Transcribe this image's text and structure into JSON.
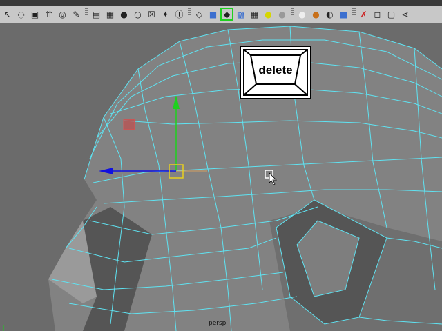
{
  "app": {
    "toolbar": {
      "icons": [
        "select-tool-icon",
        "lasso-icon",
        "paint-select-icon",
        "move-icon",
        "rotate-icon",
        "scale-icon",
        "snap-grid-icon",
        "snap-curve-icon",
        "snap-point-icon",
        "snap-plane-icon",
        "make-live-icon",
        "text-icon",
        "cube-wire-icon",
        "cube-shaded-icon",
        "cube-selected-icon",
        "checker-icon",
        "light-icon",
        "sphere-icon",
        "teapot-icon",
        "render-icon",
        "ipr-icon",
        "camera-icon",
        "wrench-icon",
        "box-icon",
        "grid-layout-icon",
        "share-icon"
      ],
      "active_icon": "cube-selected-icon"
    },
    "overlay": {
      "delete_key_label": "delete"
    },
    "viewport": {
      "camera_label": "persp"
    },
    "colors": {
      "viewport_bg": "#6b6b6b",
      "wireframe": "#55e0f0",
      "manipulator_y": "#1ed11e",
      "manipulator_x": "#1010e0",
      "manipulator_center": "#e8d020"
    }
  }
}
